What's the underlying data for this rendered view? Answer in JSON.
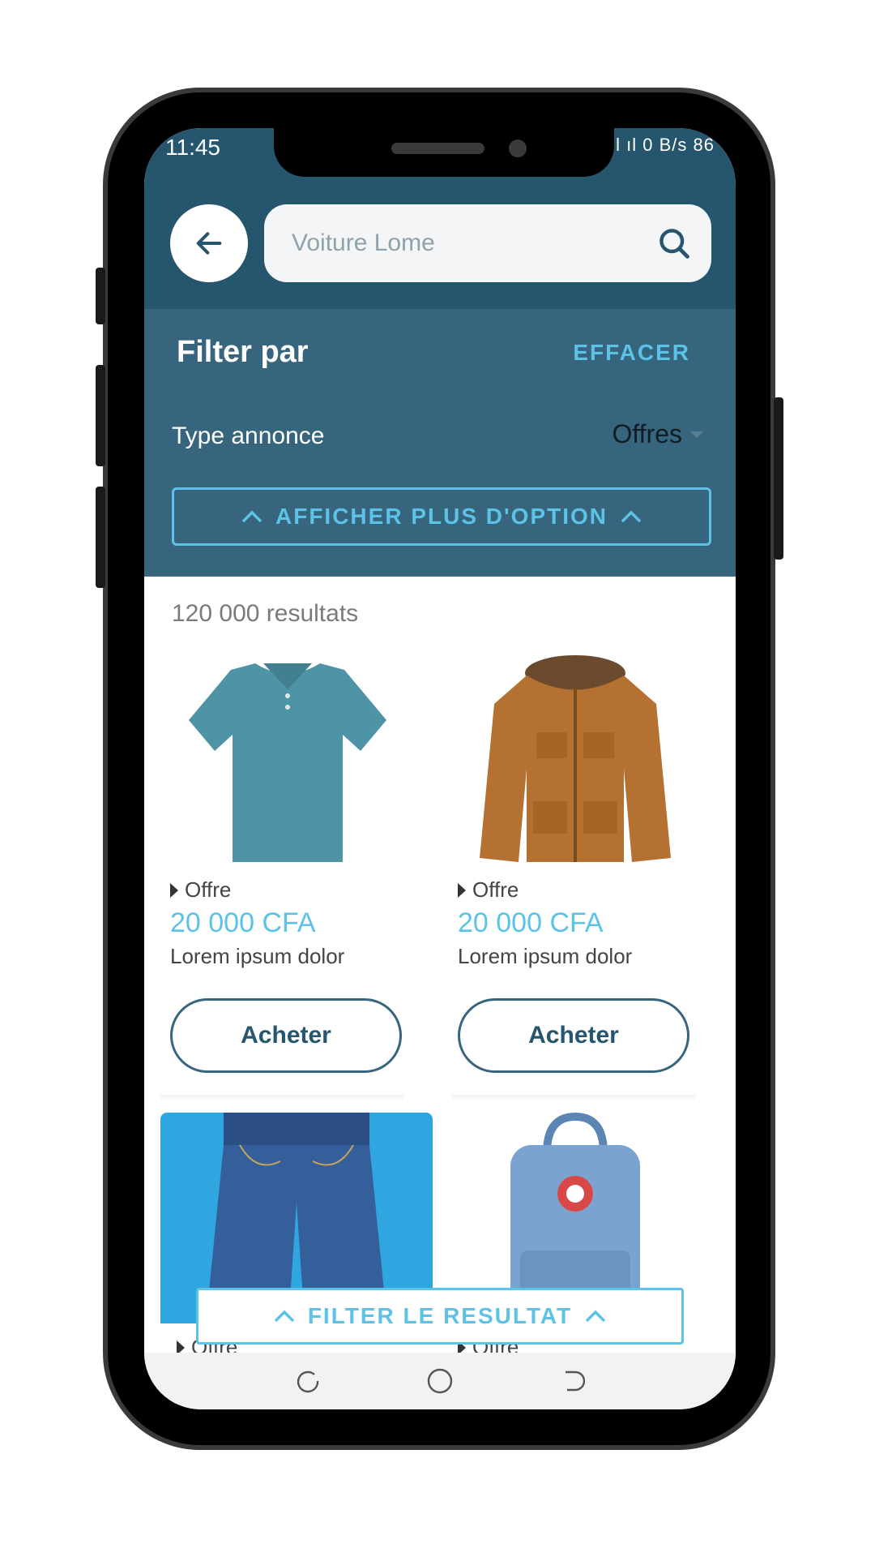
{
  "status": {
    "time": "11:45",
    "right": "0\nB/s  86"
  },
  "search": {
    "placeholder": "Voiture Lome"
  },
  "filter": {
    "title": "Filter par",
    "clear_label": "EFFACER",
    "type_label": "Type annonce",
    "type_value": "Offres",
    "more_options_label": "AFFICHER PLUS D'OPTION"
  },
  "results": {
    "count_text": "120 000 resultats"
  },
  "products": [
    {
      "kind": "Offre",
      "price": "20 000 CFA",
      "desc": "Lorem ipsum dolor",
      "buy_label": "Acheter",
      "image": "polo-shirt"
    },
    {
      "kind": "Offre",
      "price": "20 000 CFA",
      "desc": "Lorem ipsum dolor",
      "buy_label": "Acheter",
      "image": "jacket"
    },
    {
      "kind": "Offre",
      "image": "jeans"
    },
    {
      "kind": "Offre",
      "image": "backpack"
    }
  ],
  "floating": {
    "filter_result_label": "FILTER LE RESULTAT"
  },
  "colors": {
    "header": "#25566e",
    "filter_bg": "#36657d",
    "accent": "#5cc2e6"
  }
}
